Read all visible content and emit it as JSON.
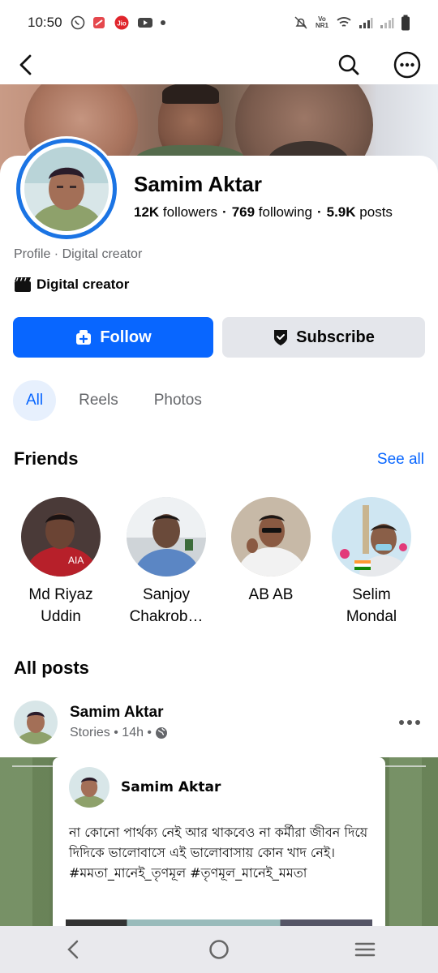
{
  "status_bar": {
    "time": "10:50",
    "carrier_badge": "Jio",
    "network_label": "Vo NR1"
  },
  "profile": {
    "name": "Samim Aktar",
    "followers_count": "12K",
    "followers_label": "followers",
    "following_count": "769",
    "following_label": "following",
    "posts_count": "5.9K",
    "posts_label": "posts",
    "subtitle": "Profile · Digital creator",
    "category": "Digital creator"
  },
  "actions": {
    "follow_label": "Follow",
    "subscribe_label": "Subscribe"
  },
  "tabs": [
    {
      "label": "All",
      "active": true
    },
    {
      "label": "Reels",
      "active": false
    },
    {
      "label": "Photos",
      "active": false
    }
  ],
  "friends": {
    "title": "Friends",
    "see_all_label": "See all",
    "items": [
      {
        "name": "Md Riyaz Uddin"
      },
      {
        "name": "Sanjoy Chakrob…"
      },
      {
        "name": "AB AB"
      },
      {
        "name": "Selim Mondal"
      }
    ]
  },
  "posts": {
    "title": "All posts",
    "first": {
      "author": "Samim Aktar",
      "meta": "Stories • 14h •",
      "inner_author": "Samim Aktar",
      "inner_text": "না কোনো পার্থক্য নেই আর থাকবেও না কর্মীরা জীবন দিয়ে দিদিকে ভালোবাসে এই ভালোবাসায় কোন খাদ নেই। #মমতা_মানেই_তৃণমূল #তৃণমূল_মানেই_মমতা"
    }
  },
  "colors": {
    "accent": "#0866ff",
    "follow_button": "#0866ff",
    "subscribe_button": "#e4e6eb",
    "active_tab_bg": "#e7f0fd",
    "avatar_ring": "#1b74e4",
    "muted_text": "#65676b"
  },
  "icons": {
    "back": "arrow-left-icon",
    "search": "search-icon",
    "more": "more-circle-icon",
    "follow": "add-friend-icon",
    "subscribe": "shield-check-icon",
    "creator": "clapperboard-icon",
    "globe": "globe-icon",
    "post_more": "ellipsis-icon"
  }
}
